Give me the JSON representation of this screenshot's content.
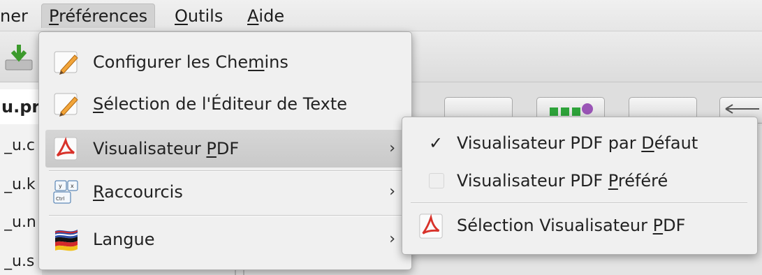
{
  "menubar": {
    "items": [
      {
        "label": "ner"
      },
      {
        "label": "Préférences",
        "mnemonic": "P",
        "rest": "références"
      },
      {
        "label": "Outils",
        "mnemonic": "O",
        "rest": "utils"
      },
      {
        "label": "Aide",
        "mnemonic": "A",
        "rest": "ide"
      }
    ]
  },
  "left_panel": {
    "active_tab": "u.pr",
    "items": [
      "_u.c",
      "_u.k",
      "_u.n",
      "_u.s"
    ]
  },
  "preferences_menu": {
    "items": [
      {
        "pre": "Configurer les Che",
        "mnemonic": "m",
        "post": "ins",
        "icon": "pencil-document-icon",
        "has_submenu": false
      },
      {
        "pre": "",
        "mnemonic": "S",
        "post": "élection de l'Éditeur de Texte",
        "icon": "pencil-document-icon",
        "has_submenu": false
      },
      {
        "pre": "Visualisateur ",
        "mnemonic": "P",
        "post": "DF",
        "icon": "pdf-icon",
        "has_submenu": true,
        "highlighted": true
      },
      {
        "pre": "",
        "mnemonic": "R",
        "post": "accourcis",
        "icon": "keyboard-shortcut-icon",
        "has_submenu": true
      },
      {
        "pre": "Langue",
        "mnemonic": "",
        "post": "",
        "icon": "language-flag-icon",
        "has_submenu": true
      }
    ],
    "submenu_arrow": "›"
  },
  "pdf_submenu": {
    "items": [
      {
        "pre": "Visualisateur PDF par ",
        "mnemonic": "D",
        "post": "éfaut",
        "checked": true,
        "check_glyph": "✓"
      },
      {
        "pre": "Visualisateur PDF ",
        "mnemonic": "P",
        "post": "référé",
        "checked": false
      },
      {
        "pre": "Sélection Visualisateur ",
        "mnemonic": "P",
        "post": "DF",
        "icon": "pdf-icon"
      }
    ]
  },
  "colors": {
    "pdf_red": "#d8322a",
    "menu_bg": "#f0f0f0",
    "highlight_bg": "#cccccc"
  }
}
